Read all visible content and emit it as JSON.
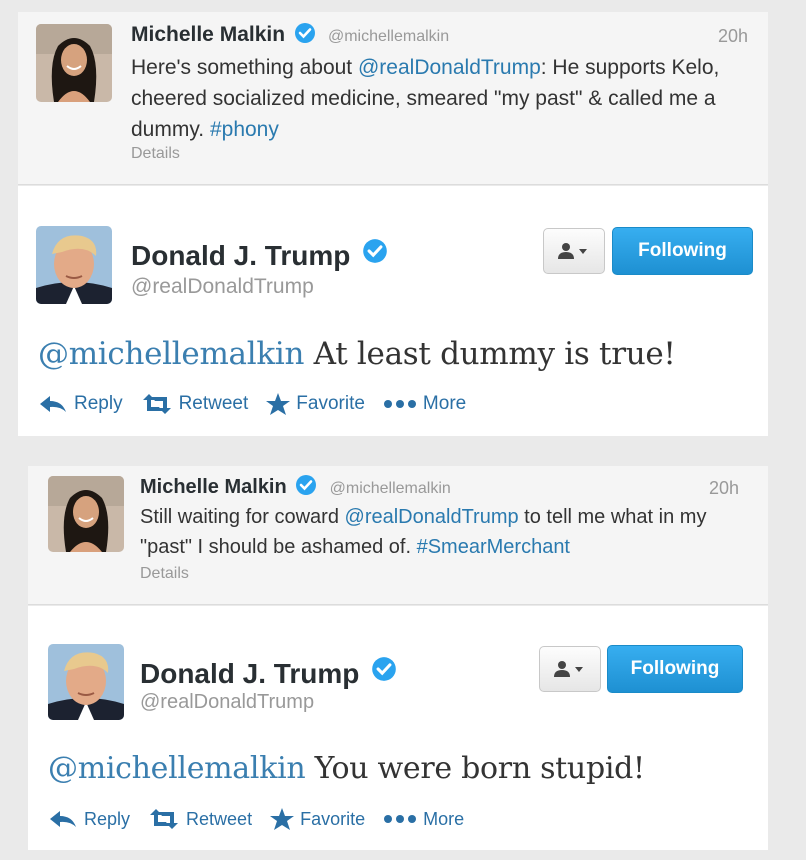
{
  "threads": [
    {
      "reply": {
        "name": "Michelle Malkin",
        "handle": "@michellemalkin",
        "time": "20h",
        "text_parts": [
          {
            "t": "Here's something about ",
            "link": false
          },
          {
            "t": "@realDonaldTrump",
            "link": true
          },
          {
            "t": ": He supports Kelo, cheered socialized medicine, smeared \"my past\" & called me a dummy. ",
            "link": false
          },
          {
            "t": "#phony",
            "link": true
          }
        ],
        "details": "Details"
      },
      "main": {
        "name": "Donald J. Trump",
        "handle": "@realDonaldTrump",
        "follow_label": "Following",
        "mention": "@michellemalkin",
        "text": " At least dummy is true!",
        "actions": {
          "reply": "Reply",
          "retweet": "Retweet",
          "favorite": "Favorite",
          "more": "More"
        }
      }
    },
    {
      "reply": {
        "name": "Michelle Malkin",
        "handle": "@michellemalkin",
        "time": "20h",
        "text_parts": [
          {
            "t": "Still waiting for coward ",
            "link": false
          },
          {
            "t": "@realDonaldTrump",
            "link": true
          },
          {
            "t": " to tell me what in my \"past\" I should be ashamed of. ",
            "link": false
          },
          {
            "t": "#SmearMerchant",
            "link": true
          }
        ],
        "details": "Details"
      },
      "main": {
        "name": "Donald J. Trump",
        "handle": "@realDonaldTrump",
        "follow_label": "Following",
        "mention": "@michellemalkin",
        "text": " You were born stupid!",
        "actions": {
          "reply": "Reply",
          "retweet": "Retweet",
          "favorite": "Favorite",
          "more": "More"
        }
      }
    }
  ],
  "colors": {
    "link": "#2a7aaf",
    "follow_button": "#1e90d2",
    "verified": "#2aa3ef"
  }
}
